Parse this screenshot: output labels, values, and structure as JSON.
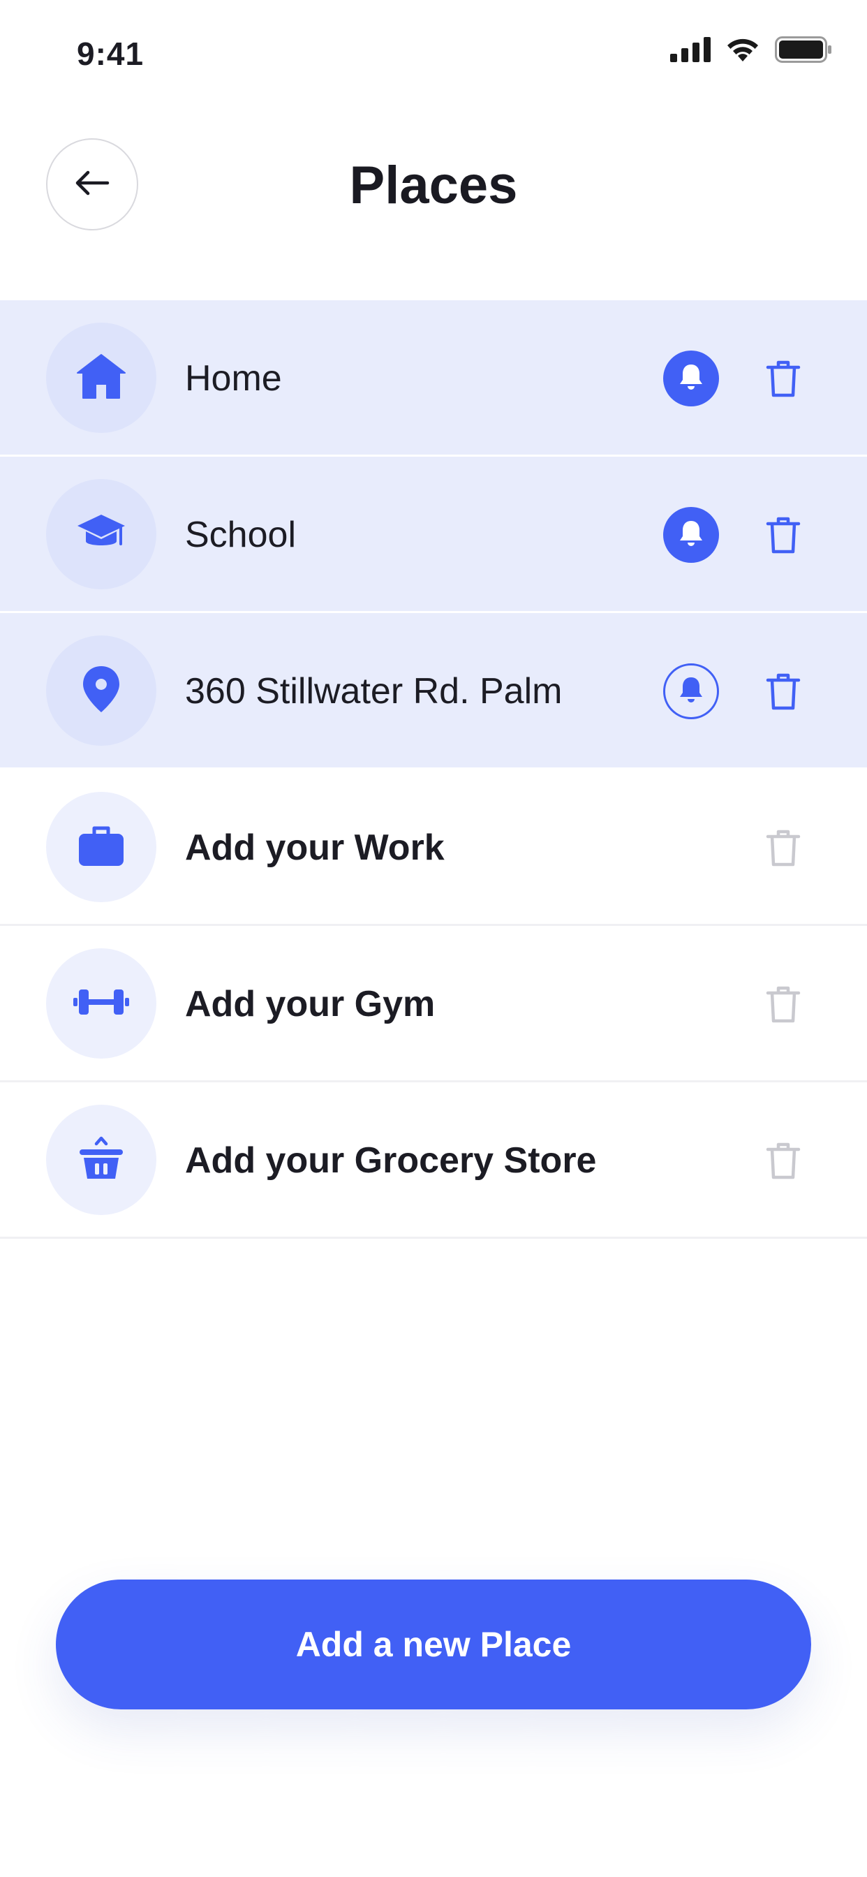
{
  "status_bar": {
    "time": "9:41",
    "icons": [
      "signal-icon",
      "wifi-icon",
      "battery-icon"
    ]
  },
  "header": {
    "title": "Places",
    "back_icon": "arrow-left-icon"
  },
  "places": [
    {
      "label": "Home",
      "icon": "home-icon",
      "saved": true,
      "notifications": "on",
      "delete_icon": "trash-icon"
    },
    {
      "label": "School",
      "icon": "graduation-cap-icon",
      "saved": true,
      "notifications": "on",
      "delete_icon": "trash-icon"
    },
    {
      "label": "360 Stillwater Rd. Palm",
      "icon": "location-pin-icon",
      "saved": true,
      "notifications": "off",
      "delete_icon": "trash-icon"
    },
    {
      "label": "Add your Work",
      "icon": "briefcase-icon",
      "saved": false,
      "delete_icon": "trash-icon"
    },
    {
      "label": "Add your Gym",
      "icon": "dumbbell-icon",
      "saved": false,
      "delete_icon": "trash-icon"
    },
    {
      "label": "Add your Grocery Store",
      "icon": "basket-icon",
      "saved": false,
      "delete_icon": "trash-icon"
    }
  ],
  "cta": {
    "label": "Add a new Place"
  },
  "colors": {
    "accent": "#4160f5",
    "saved_row_bg": "#e8ecfc",
    "icon_circle_bg": "#dde3fb",
    "disabled_icon": "#c9c9cf",
    "text": "#1c1c24"
  }
}
